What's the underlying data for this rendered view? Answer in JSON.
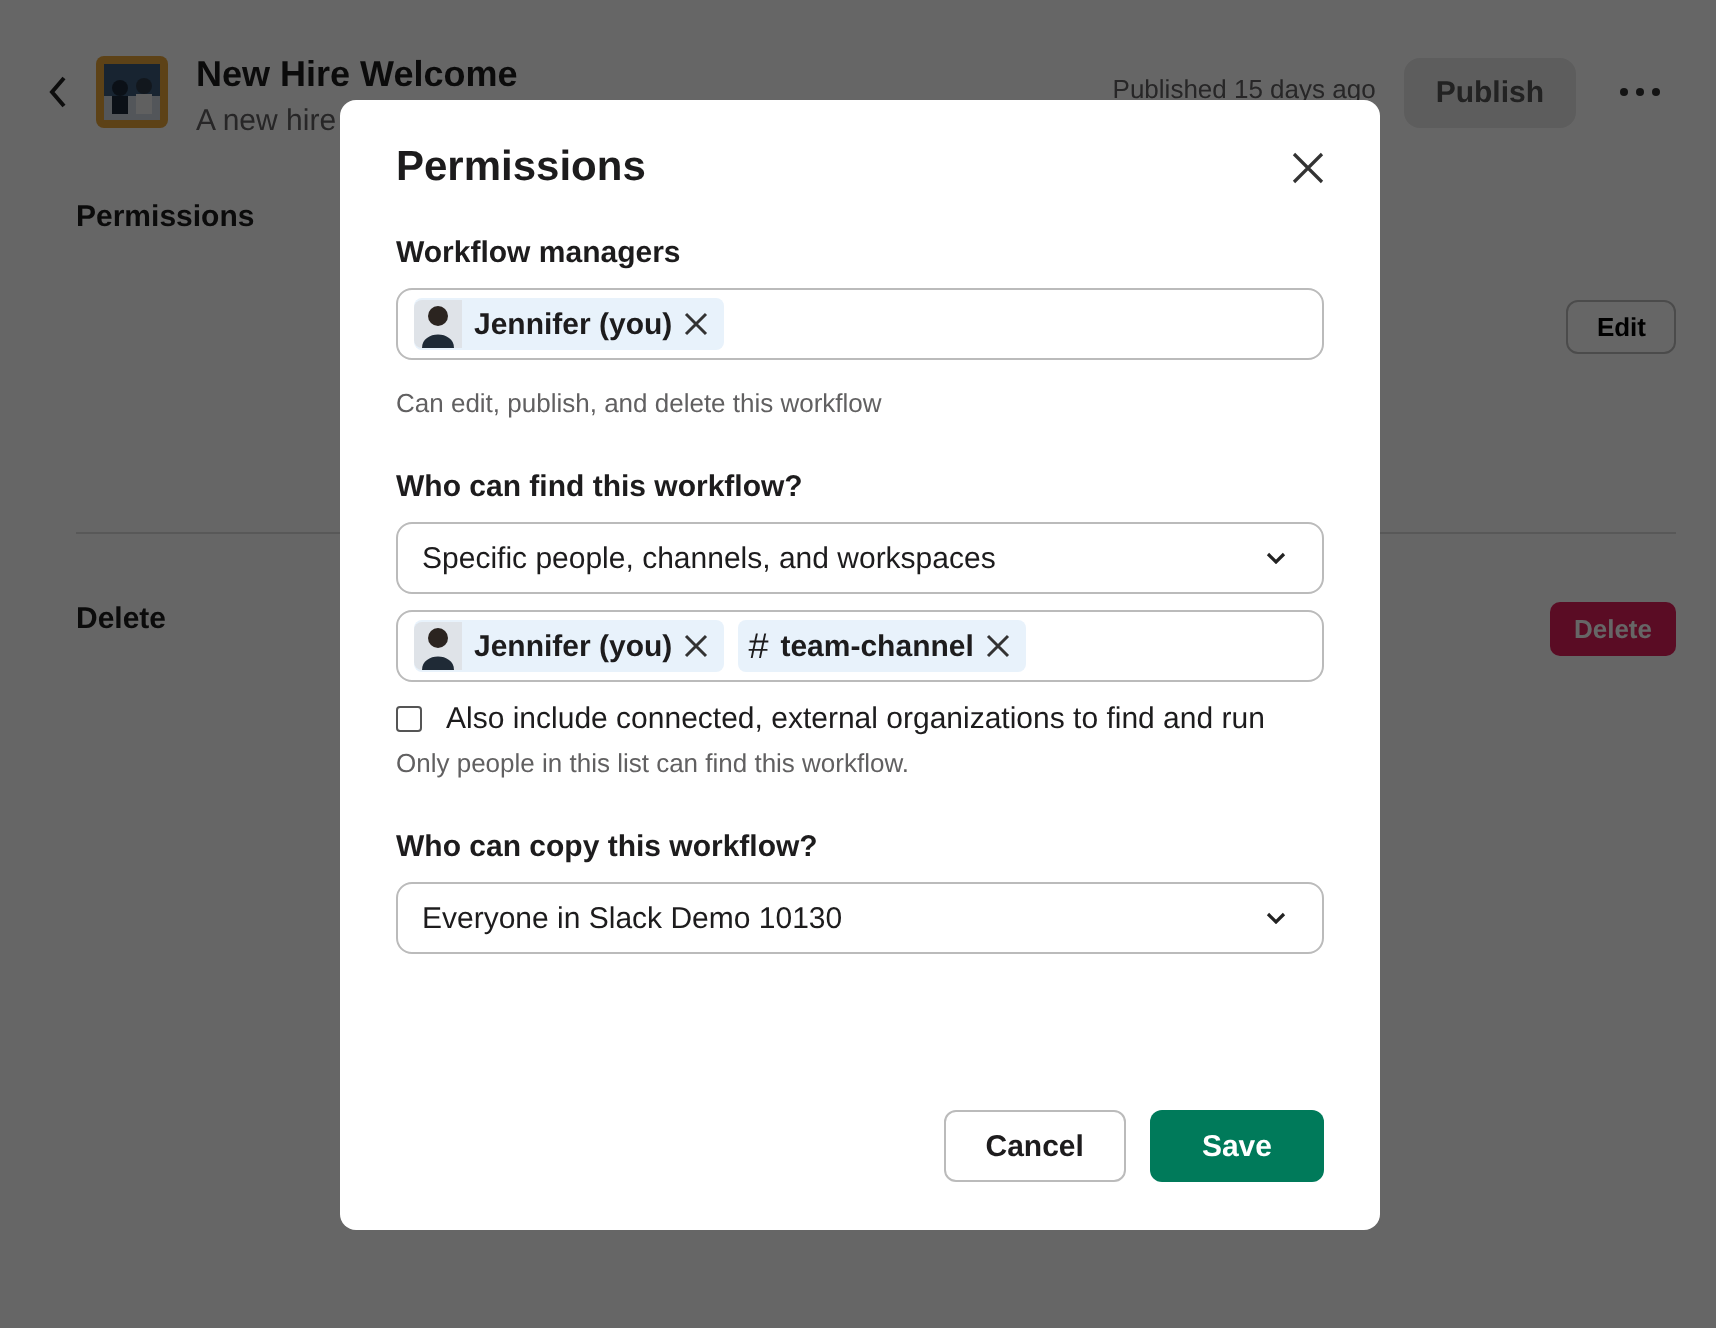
{
  "header": {
    "title": "New Hire Welcome",
    "subtitle": "A new hire",
    "status": "Published 15 days ago",
    "publish_button": "Publish"
  },
  "sections": [
    {
      "kind": "edit",
      "label": "Permissions",
      "button": "Edit"
    },
    {
      "kind": "delete",
      "label": "Delete",
      "button": "Delete"
    }
  ],
  "dialog": {
    "title": "Permissions",
    "managers": {
      "label": "Workflow managers",
      "tokens": [
        {
          "kind": "person",
          "label": "Jennifer (you)"
        }
      ],
      "hint": "Can edit, publish, and delete this workflow"
    },
    "find": {
      "label": "Who can find this workflow?",
      "value": "Specific people, channels, and workspaces",
      "tokens": [
        {
          "kind": "person",
          "label": "Jennifer (you)"
        },
        {
          "kind": "channel",
          "symbol": "#",
          "label": "team-channel"
        }
      ],
      "checkbox": {
        "label": "Also include connected, external organizations to find and run",
        "checked": false
      },
      "hint": "Only people in this list can find this workflow."
    },
    "copy": {
      "label": "Who can copy this workflow?",
      "value": "Everyone in Slack Demo 10130"
    },
    "buttons": [
      {
        "kind": "secondary",
        "label": "Cancel"
      },
      {
        "kind": "primary",
        "label": "Save"
      }
    ]
  }
}
